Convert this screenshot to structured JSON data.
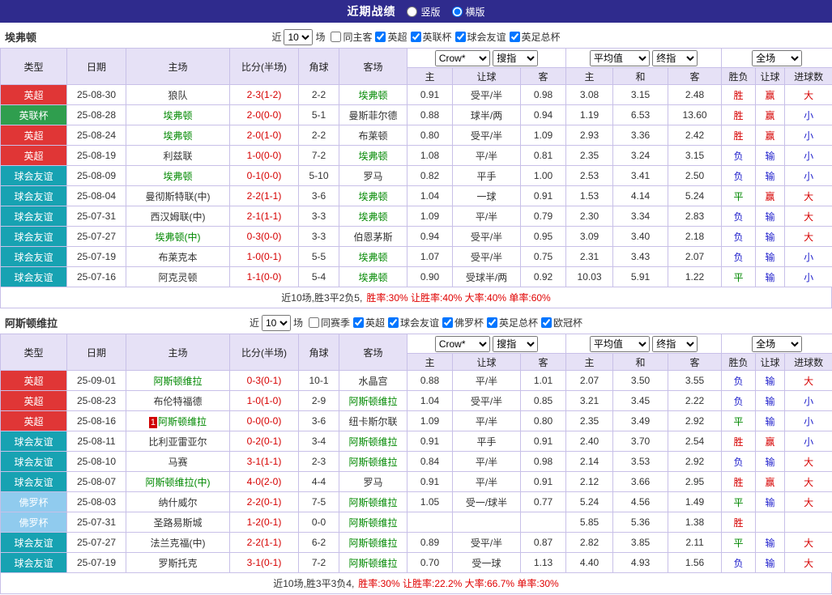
{
  "topbar": {
    "title": "近期战绩",
    "radios": [
      {
        "label": "竖版",
        "checked": false
      },
      {
        "label": "横版",
        "checked": true
      }
    ]
  },
  "table_header": {
    "cols": [
      "类型",
      "日期",
      "主场",
      "比分(半场)",
      "角球",
      "客场"
    ],
    "sub": [
      "主",
      "让球",
      "客",
      "主",
      "和",
      "客",
      "胜负",
      "让球",
      "进球数"
    ]
  },
  "colors": {
    "topbar_bg": "#2f2b8d",
    "header_bg": "#e6e1f6",
    "border": "#c8c0e8",
    "score": "#d60000",
    "team_highlight": "#008800",
    "summary_highlight": "#e00000",
    "result": {
      "胜": "#d60000",
      "平": "#008800",
      "负": "#2020cc",
      "赢": "#d60000",
      "输": "#2020cc",
      "大": "#d60000",
      "小": "#2020cc"
    },
    "league": {
      "英超": "#e03636",
      "英联杯": "#2f9e4e",
      "球会友谊": "#17a2b2",
      "佛罗杯": "#90cbee"
    }
  },
  "sections": [
    {
      "team": "埃弗顿",
      "filter": {
        "near_label": "近",
        "count": "10",
        "unit": "场",
        "checkboxes": [
          {
            "label": "同主客",
            "checked": false
          },
          {
            "label": "英超",
            "checked": true
          },
          {
            "label": "英联杯",
            "checked": true
          },
          {
            "label": "球会友谊",
            "checked": true
          },
          {
            "label": "英足总杯",
            "checked": true
          }
        ]
      },
      "selects": {
        "odds1": "Crow*",
        "odds2": "搜指",
        "avg1": "平均值",
        "avg2": "终指",
        "result": "全场"
      },
      "rows": [
        {
          "type": "英超",
          "date": "25-08-30",
          "home": "狼队",
          "home_hl": false,
          "score": "2-3(1-2)",
          "corner": "2-2",
          "away": "埃弗顿",
          "away_hl": true,
          "o1": "0.91",
          "handicap": "受平/半",
          "o2": "0.98",
          "a1": "3.08",
          "a2": "3.15",
          "a3": "2.48",
          "r1": "胜",
          "r2": "赢",
          "r3": "大"
        },
        {
          "type": "英联杯",
          "date": "25-08-28",
          "home": "埃弗顿",
          "home_hl": true,
          "score": "2-0(0-0)",
          "corner": "5-1",
          "away": "曼斯菲尔德",
          "away_hl": false,
          "o1": "0.88",
          "handicap": "球半/两",
          "o2": "0.94",
          "a1": "1.19",
          "a2": "6.53",
          "a3": "13.60",
          "r1": "胜",
          "r2": "赢",
          "r3": "小"
        },
        {
          "type": "英超",
          "date": "25-08-24",
          "home": "埃弗顿",
          "home_hl": true,
          "score": "2-0(1-0)",
          "corner": "2-2",
          "away": "布莱顿",
          "away_hl": false,
          "o1": "0.80",
          "handicap": "受平/半",
          "o2": "1.09",
          "a1": "2.93",
          "a2": "3.36",
          "a3": "2.42",
          "r1": "胜",
          "r2": "赢",
          "r3": "小"
        },
        {
          "type": "英超",
          "date": "25-08-19",
          "home": "利兹联",
          "home_hl": false,
          "score": "1-0(0-0)",
          "corner": "7-2",
          "away": "埃弗顿",
          "away_hl": true,
          "o1": "1.08",
          "handicap": "平/半",
          "o2": "0.81",
          "a1": "2.35",
          "a2": "3.24",
          "a3": "3.15",
          "r1": "负",
          "r2": "输",
          "r3": "小"
        },
        {
          "type": "球会友谊",
          "date": "25-08-09",
          "home": "埃弗顿",
          "home_hl": true,
          "score": "0-1(0-0)",
          "corner": "5-10",
          "away": "罗马",
          "away_hl": false,
          "o1": "0.82",
          "handicap": "平手",
          "o2": "1.00",
          "a1": "2.53",
          "a2": "3.41",
          "a3": "2.50",
          "r1": "负",
          "r2": "输",
          "r3": "小"
        },
        {
          "type": "球会友谊",
          "date": "25-08-04",
          "home": "曼彻斯特联(中)",
          "home_hl": false,
          "score": "2-2(1-1)",
          "corner": "3-6",
          "away": "埃弗顿",
          "away_hl": true,
          "o1": "1.04",
          "handicap": "一球",
          "o2": "0.91",
          "a1": "1.53",
          "a2": "4.14",
          "a3": "5.24",
          "r1": "平",
          "r2": "赢",
          "r3": "大"
        },
        {
          "type": "球会友谊",
          "date": "25-07-31",
          "home": "西汉姆联(中)",
          "home_hl": false,
          "score": "2-1(1-1)",
          "corner": "3-3",
          "away": "埃弗顿",
          "away_hl": true,
          "o1": "1.09",
          "handicap": "平/半",
          "o2": "0.79",
          "a1": "2.30",
          "a2": "3.34",
          "a3": "2.83",
          "r1": "负",
          "r2": "输",
          "r3": "大"
        },
        {
          "type": "球会友谊",
          "date": "25-07-27",
          "home": "埃弗顿(中)",
          "home_hl": true,
          "score": "0-3(0-0)",
          "corner": "3-3",
          "away": "伯恩茅斯",
          "away_hl": false,
          "o1": "0.94",
          "handicap": "受平/半",
          "o2": "0.95",
          "a1": "3.09",
          "a2": "3.40",
          "a3": "2.18",
          "r1": "负",
          "r2": "输",
          "r3": "大"
        },
        {
          "type": "球会友谊",
          "date": "25-07-19",
          "home": "布莱克本",
          "home_hl": false,
          "score": "1-0(0-1)",
          "corner": "5-5",
          "away": "埃弗顿",
          "away_hl": true,
          "o1": "1.07",
          "handicap": "受平/半",
          "o2": "0.75",
          "a1": "2.31",
          "a2": "3.43",
          "a3": "2.07",
          "r1": "负",
          "r2": "输",
          "r3": "小"
        },
        {
          "type": "球会友谊",
          "date": "25-07-16",
          "home": "阿克灵顿",
          "home_hl": false,
          "score": "1-1(0-0)",
          "corner": "5-4",
          "away": "埃弗顿",
          "away_hl": true,
          "o1": "0.90",
          "handicap": "受球半/两",
          "o2": "0.92",
          "a1": "10.03",
          "a2": "5.91",
          "a3": "1.22",
          "r1": "平",
          "r2": "输",
          "r3": "小"
        }
      ],
      "summary": {
        "record": "近10场,胜3平2负5,",
        "rates": "胜率:30% 让胜率:40% 大率:40% 单率:60%"
      }
    },
    {
      "team": "阿斯顿维拉",
      "filter": {
        "near_label": "近",
        "count": "10",
        "unit": "场",
        "checkboxes": [
          {
            "label": "同赛季",
            "checked": false
          },
          {
            "label": "英超",
            "checked": true
          },
          {
            "label": "球会友谊",
            "checked": true
          },
          {
            "label": "佛罗杯",
            "checked": true
          },
          {
            "label": "英足总杯",
            "checked": true
          },
          {
            "label": "欧冠杯",
            "checked": true
          }
        ]
      },
      "selects": {
        "odds1": "Crow*",
        "odds2": "搜指",
        "avg1": "平均值",
        "avg2": "终指",
        "result": "全场"
      },
      "rows": [
        {
          "type": "英超",
          "date": "25-09-01",
          "home": "阿斯顿维拉",
          "home_hl": true,
          "score": "0-3(0-1)",
          "corner": "10-1",
          "away": "水晶宫",
          "away_hl": false,
          "o1": "0.88",
          "handicap": "平/半",
          "o2": "1.01",
          "a1": "2.07",
          "a2": "3.50",
          "a3": "3.55",
          "r1": "负",
          "r2": "输",
          "r3": "大"
        },
        {
          "type": "英超",
          "date": "25-08-23",
          "home": "布伦特福德",
          "home_hl": false,
          "score": "1-0(1-0)",
          "corner": "2-9",
          "away": "阿斯顿维拉",
          "away_hl": true,
          "o1": "1.04",
          "handicap": "受平/半",
          "o2": "0.85",
          "a1": "3.21",
          "a2": "3.45",
          "a3": "2.22",
          "r1": "负",
          "r2": "输",
          "r3": "小"
        },
        {
          "type": "英超",
          "date": "25-08-16",
          "home": "阿斯顿维拉",
          "home_hl": true,
          "home_badge": "1",
          "score": "0-0(0-0)",
          "corner": "3-6",
          "away": "纽卡斯尔联",
          "away_hl": false,
          "o1": "1.09",
          "handicap": "平/半",
          "o2": "0.80",
          "a1": "2.35",
          "a2": "3.49",
          "a3": "2.92",
          "r1": "平",
          "r2": "输",
          "r3": "小"
        },
        {
          "type": "球会友谊",
          "date": "25-08-11",
          "home": "比利亚雷亚尔",
          "home_hl": false,
          "score": "0-2(0-1)",
          "corner": "3-4",
          "away": "阿斯顿维拉",
          "away_hl": true,
          "o1": "0.91",
          "handicap": "平手",
          "o2": "0.91",
          "a1": "2.40",
          "a2": "3.70",
          "a3": "2.54",
          "r1": "胜",
          "r2": "赢",
          "r3": "小"
        },
        {
          "type": "球会友谊",
          "date": "25-08-10",
          "home": "马赛",
          "home_hl": false,
          "score": "3-1(1-1)",
          "corner": "2-3",
          "away": "阿斯顿维拉",
          "away_hl": true,
          "o1": "0.84",
          "handicap": "平/半",
          "o2": "0.98",
          "a1": "2.14",
          "a2": "3.53",
          "a3": "2.92",
          "r1": "负",
          "r2": "输",
          "r3": "大"
        },
        {
          "type": "球会友谊",
          "date": "25-08-07",
          "home": "阿斯顿维拉(中)",
          "home_hl": true,
          "score": "4-0(2-0)",
          "corner": "4-4",
          "away": "罗马",
          "away_hl": false,
          "o1": "0.91",
          "handicap": "平/半",
          "o2": "0.91",
          "a1": "2.12",
          "a2": "3.66",
          "a3": "2.95",
          "r1": "胜",
          "r2": "赢",
          "r3": "大"
        },
        {
          "type": "佛罗杯",
          "date": "25-08-03",
          "home": "纳什威尔",
          "home_hl": false,
          "score": "2-2(0-1)",
          "corner": "7-5",
          "away": "阿斯顿维拉",
          "away_hl": true,
          "o1": "1.05",
          "handicap": "受一/球半",
          "o2": "0.77",
          "a1": "5.24",
          "a2": "4.56",
          "a3": "1.49",
          "r1": "平",
          "r2": "输",
          "r3": "大"
        },
        {
          "type": "佛罗杯",
          "date": "25-07-31",
          "home": "圣路易斯城",
          "home_hl": false,
          "score": "1-2(0-1)",
          "corner": "0-0",
          "away": "阿斯顿维拉",
          "away_hl": true,
          "o1": "",
          "handicap": "",
          "o2": "",
          "a1": "5.85",
          "a2": "5.36",
          "a3": "1.38",
          "r1": "胜",
          "r2": "",
          "r3": ""
        },
        {
          "type": "球会友谊",
          "date": "25-07-27",
          "home": "法兰克福(中)",
          "home_hl": false,
          "score": "2-2(1-1)",
          "corner": "6-2",
          "away": "阿斯顿维拉",
          "away_hl": true,
          "o1": "0.89",
          "handicap": "受平/半",
          "o2": "0.87",
          "a1": "2.82",
          "a2": "3.85",
          "a3": "2.11",
          "r1": "平",
          "r2": "输",
          "r3": "大"
        },
        {
          "type": "球会友谊",
          "date": "25-07-19",
          "home": "罗斯托克",
          "home_hl": false,
          "score": "3-1(0-1)",
          "corner": "7-2",
          "away": "阿斯顿维拉",
          "away_hl": true,
          "o1": "0.70",
          "handicap": "受一球",
          "o2": "1.13",
          "a1": "4.40",
          "a2": "4.93",
          "a3": "1.56",
          "r1": "负",
          "r2": "输",
          "r3": "大"
        }
      ],
      "summary": {
        "record": "近10场,胜3平3负4,",
        "rates": "胜率:30% 让胜率:22.2% 大率:66.7% 单率:30%"
      }
    }
  ]
}
